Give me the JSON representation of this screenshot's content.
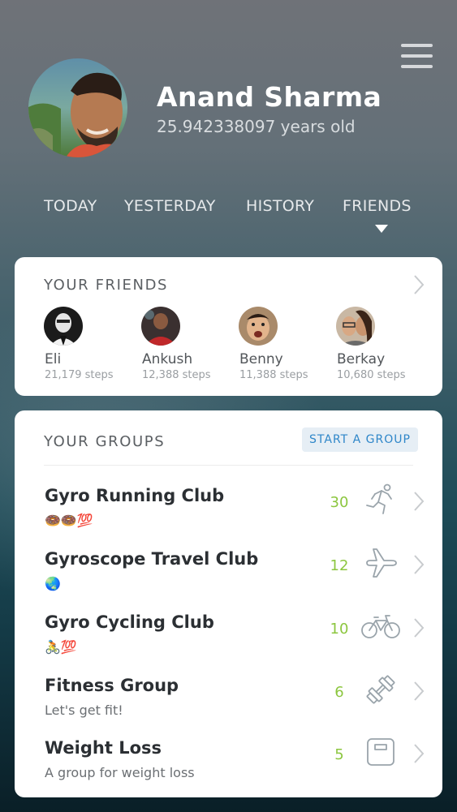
{
  "profile": {
    "name": "Anand Sharma",
    "age": "25.942338097 years old"
  },
  "tabs": [
    {
      "label": "TODAY"
    },
    {
      "label": "YESTERDAY"
    },
    {
      "label": "HISTORY"
    },
    {
      "label": "FRIENDS",
      "active": true
    }
  ],
  "friends_card": {
    "title": "YOUR FRIENDS",
    "friends": [
      {
        "name": "Eli",
        "steps": "21,179 steps"
      },
      {
        "name": "Ankush",
        "steps": "12,388 steps"
      },
      {
        "name": "Benny",
        "steps": "11,388 steps"
      },
      {
        "name": "Berkay",
        "steps": "10,680 steps"
      }
    ]
  },
  "groups_card": {
    "title": "YOUR GROUPS",
    "start_label": "START A GROUP",
    "groups": [
      {
        "name": "Gyro Running Club",
        "subtitle": "🍩🍩💯",
        "count": "30",
        "icon": "running-icon"
      },
      {
        "name": "Gyroscope Travel Club",
        "subtitle": "🌏",
        "count": "12",
        "icon": "airplane-icon"
      },
      {
        "name": "Gyro Cycling Club",
        "subtitle": "🚴💯",
        "count": "10",
        "icon": "bicycle-icon"
      },
      {
        "name": "Fitness Group",
        "subtitle": "Let's get fit!",
        "count": "6",
        "icon": "dumbbell-icon"
      },
      {
        "name": "Weight Loss",
        "subtitle": "A group for weight loss",
        "count": "5",
        "icon": "scale-icon"
      }
    ]
  },
  "colors": {
    "accent_green": "#8cc63f",
    "accent_blue": "#2e86c9",
    "card_bg": "#ffffff"
  }
}
